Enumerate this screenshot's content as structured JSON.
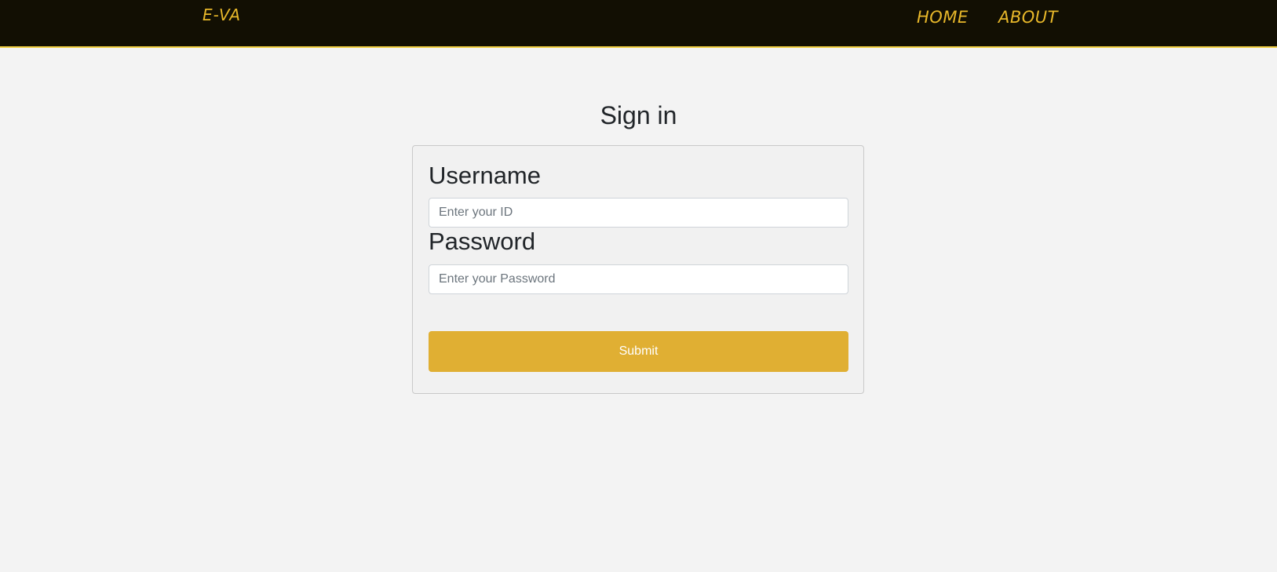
{
  "header": {
    "brand": "E-VA",
    "nav": {
      "home": "HOME",
      "about": "ABOUT"
    }
  },
  "main": {
    "title": "Sign in",
    "form": {
      "username_label": "Username",
      "username_placeholder": "Enter your ID",
      "username_value": "",
      "password_label": "Password",
      "password_placeholder": "Enter your Password",
      "password_value": "",
      "submit_label": "Submit"
    }
  },
  "colors": {
    "header_bg": "#120f03",
    "accent": "#e0af33",
    "nav_text": "#e8b82a",
    "page_bg": "#f3f3f3"
  }
}
